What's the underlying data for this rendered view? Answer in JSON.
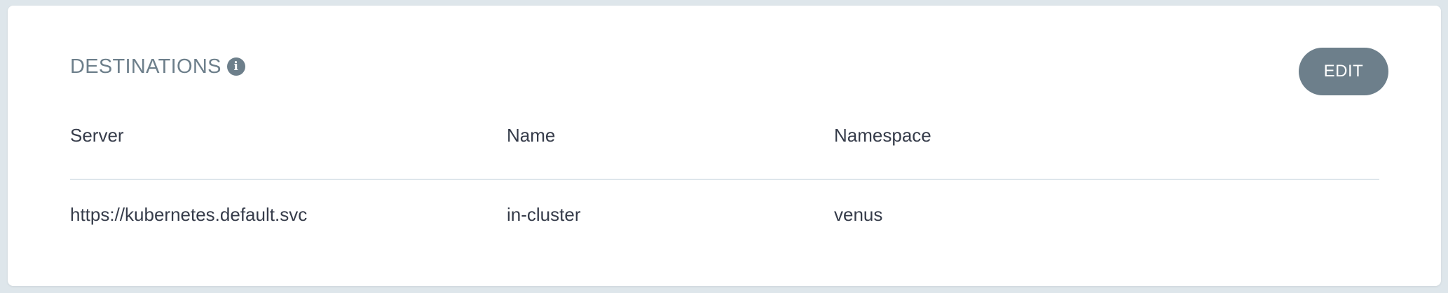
{
  "section": {
    "title": "DESTINATIONS",
    "info_icon": "info-icon"
  },
  "actions": {
    "edit_label": "EDIT"
  },
  "table": {
    "headers": [
      "Server",
      "Name",
      "Namespace"
    ],
    "rows": [
      [
        "https://kubernetes.default.svc",
        "in-cluster",
        "venus"
      ]
    ]
  },
  "colors": {
    "page_background": "#dee6eb",
    "card_background": "#ffffff",
    "accent": "#6d7f8b",
    "text": "#363c4a"
  }
}
